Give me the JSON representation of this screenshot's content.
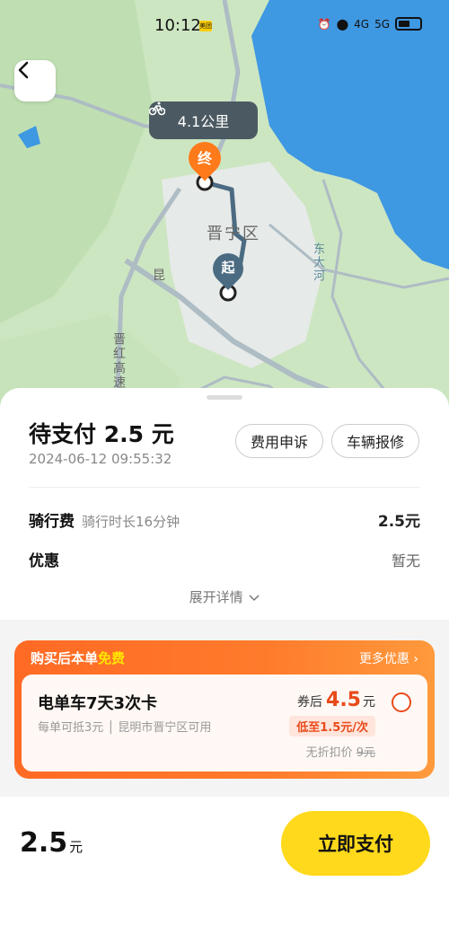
{
  "status_bar": {
    "time": "10:12",
    "app_badge": "美团",
    "network_left": "4G",
    "network_right": "5G"
  },
  "map": {
    "distance_label": "4.1公里",
    "end_marker": "终",
    "start_marker": "起",
    "district_label": "晋宁区",
    "road_label_1": "昆",
    "road_label_2": "晋红高速",
    "road_label_3": "东大河"
  },
  "order": {
    "status_title": "待支付 2.5 元",
    "datetime": "2024-06-12 09:55:32",
    "appeal_button": "费用申诉",
    "report_button": "车辆报修",
    "ride_fee_label": "骑行费",
    "ride_duration": "骑行时长16分钟",
    "ride_fee_value": "2.5元",
    "discount_label": "优惠",
    "discount_value": "暂无",
    "expand_label": "展开详情"
  },
  "promo": {
    "header_prefix": "购买后本单",
    "header_highlight": "免费",
    "more_label": "更多优惠",
    "card_name": "电单车7天3次卡",
    "card_desc": "每单可抵3元 │ 昆明市晋宁区可用",
    "after_coupon_label": "券后",
    "after_coupon_price": "4.5",
    "after_coupon_unit": "元",
    "low_badge": "低至1.5元/次",
    "no_discount_label": "无折扣价",
    "no_discount_price": "9元"
  },
  "footer": {
    "total_amount": "2.5",
    "total_unit": "元",
    "pay_button": "立即支付"
  },
  "colors": {
    "accent_yellow": "#ffd91c",
    "promo_orange": "#ff6a24",
    "price_red": "#e94a1a",
    "route_blue": "#4b6b82",
    "end_marker_orange": "#ff7a1a"
  }
}
